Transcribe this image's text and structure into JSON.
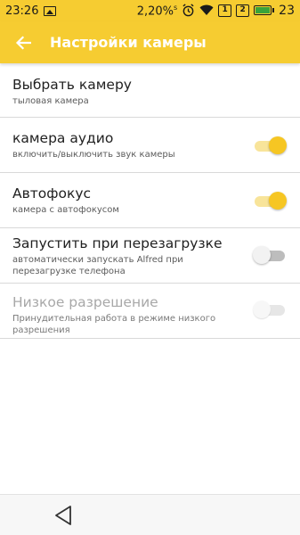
{
  "status_bar": {
    "time": "23:26",
    "data_rate": "2,20%",
    "data_rate_suffix": "s",
    "sim1": "1",
    "sim2": "2",
    "battery_level": "23",
    "icons": [
      "image-icon",
      "alarm-icon",
      "wifi-icon",
      "sim1-icon",
      "sim2-icon",
      "battery-icon"
    ]
  },
  "app_bar": {
    "title": "Настройки камеры",
    "back_icon": "arrow-back-icon",
    "color": "#f6cc31"
  },
  "settings": [
    {
      "title": "Выбрать камеру",
      "summary": "тыловая камера",
      "switch": null
    },
    {
      "title": "камера аудио",
      "summary": "включить/выключить звук камеры",
      "switch": "on"
    },
    {
      "title": "Автофокус",
      "summary": "камера с автофокусом",
      "switch": "on"
    },
    {
      "title": "Запустить при перезагрузке",
      "summary": "автоматически запускать Alfred при перезагрузке телефона",
      "switch": "off"
    },
    {
      "title": "Низкое разрешение",
      "summary": "Принудительная работа в режиме низкого разрешения",
      "switch": "disabled"
    }
  ],
  "nav_bar": {
    "back_icon": "nav-back-triangle-icon"
  },
  "colors": {
    "accent": "#f6c623",
    "divider": "#d9d9d9"
  }
}
